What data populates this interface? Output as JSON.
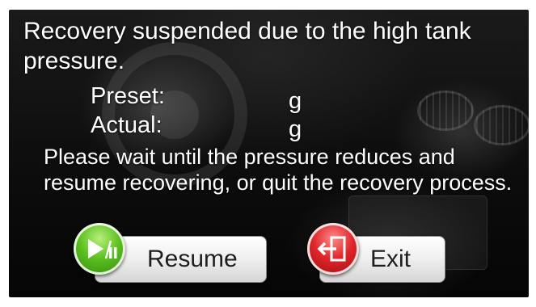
{
  "dialog": {
    "message": "Recovery suspended due to the high tank pressure.",
    "preset_label": "Preset:",
    "preset_unit": "g",
    "actual_label": "Actual:",
    "actual_unit": "g",
    "instruction": "Please wait until the pressure reduces and resume recovering, or quit the recovery process."
  },
  "buttons": {
    "resume_label": "Resume",
    "exit_label": "Exit"
  },
  "icons": {
    "resume": "play-pause-icon",
    "exit": "exit-door-icon"
  },
  "colors": {
    "background": "#0d0d0d",
    "text": "#ffffff",
    "resume_icon": "#5cc020",
    "exit_icon": "#e0262b"
  }
}
